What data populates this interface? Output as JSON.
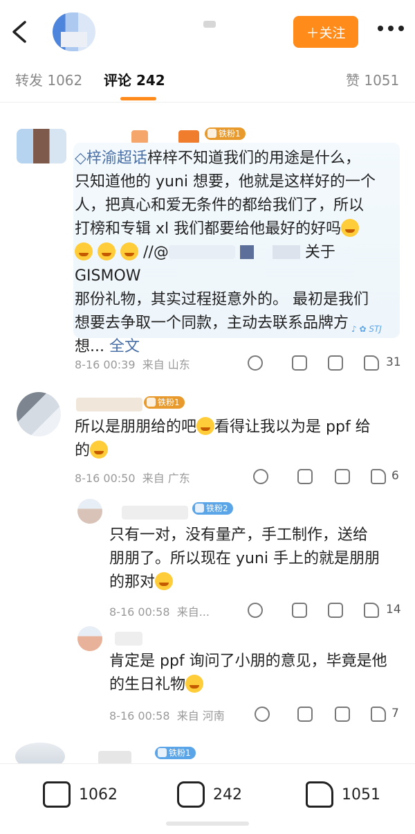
{
  "header": {
    "follow_label": "＋关注"
  },
  "tabs": [
    {
      "label": "转发 1062"
    },
    {
      "label": "评论 242"
    },
    {
      "label": "赞 1051"
    }
  ],
  "comments": [
    {
      "badge": "铁粉1",
      "topic": "梓渝超话",
      "text_lines": [
        "梓梓不知道我们的用途是什么，",
        "只知道他的 yuni 想要，他就是这样好的一个",
        "人，把真心和爱无条件的都给我们了，所以",
        "打榜和专辑 xl 我们都要给他最好的好吗"
      ],
      "line5_suffix": "关于 GISMOW",
      "line6": "那份礼物，其实过程挺意外的。 最初是我们",
      "line7": "想要去争取一个同款，主动去联系品牌方",
      "line8": "想...",
      "full_text_link": "全文",
      "time": "8-16 00:39",
      "location": "来自 山东",
      "likes": "31"
    },
    {
      "badge": "铁粉1",
      "text_line1": "所以是朋朋给的吧",
      "text_line1b": "看得让我以为是 ppf 给",
      "text_line2": "的",
      "time": "8-16 00:50",
      "location": "来自 广东",
      "likes": "6"
    },
    {
      "badge": "铁粉2",
      "text_line1": "只有一对，没有量产，手工制作，送给",
      "text_line2": "朋朋了。所以现在 yuni 手上的就是朋朋",
      "text_line3": "的那对",
      "time": "8-16 00:58",
      "location": "来自...",
      "likes": "14"
    },
    {
      "text_line1": "肯定是 ppf 询问了小朋的意见，毕竟是他",
      "text_line2": "的生日礼物",
      "time": "8-16 00:58",
      "location": "来自 河南",
      "likes": "7"
    },
    {
      "badge": "铁粉1"
    }
  ],
  "bottom_bar": {
    "repost_count": "1062",
    "comment_count": "242",
    "like_count": "1051"
  },
  "colors": {
    "accent": "#ff8b1a",
    "link": "#4a70a8",
    "badge_orange": "#f5a623",
    "badge_blue": "#5aa4e8"
  }
}
